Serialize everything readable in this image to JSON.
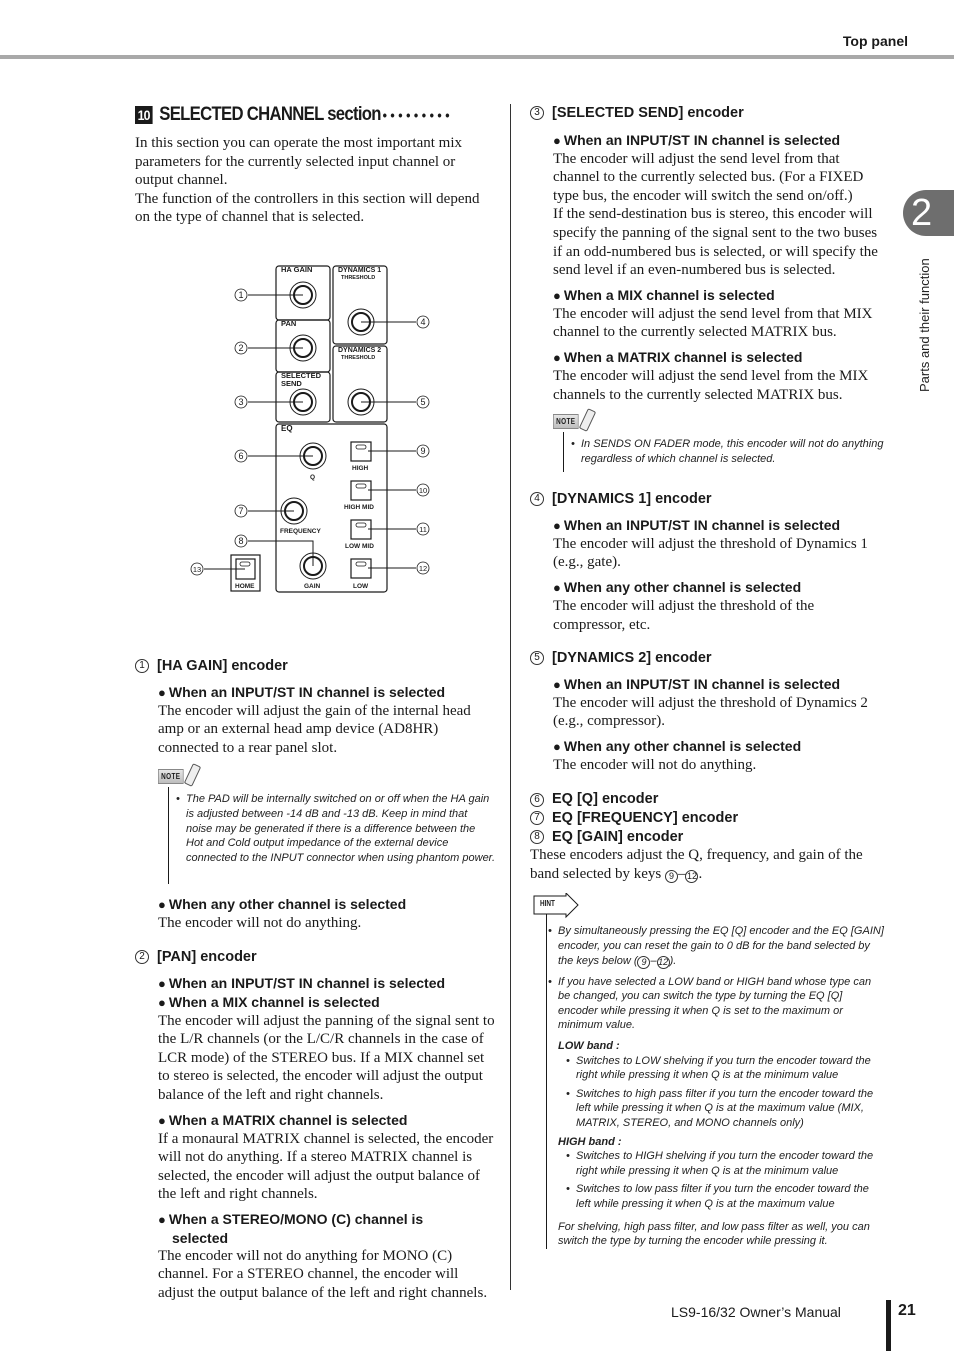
{
  "header": {
    "title": "Top panel"
  },
  "chapter": {
    "number": "2",
    "title": "Parts and their function"
  },
  "section": {
    "number": "10",
    "title": "SELECTED CHANNEL section",
    "dots": "•••••••••",
    "intro": [
      "In this section you can operate the most important mix parameters for the currently selected input channel or output channel.",
      "The function of the controllers in this section will depend on the type of channel that is selected."
    ]
  },
  "diagram": {
    "panels": {
      "ha_gain": "HA GAIN",
      "pan": "PAN",
      "selected_send_1": "SELECTED",
      "selected_send_2": "SEND",
      "dyn1": "DYNAMICS 1",
      "dyn1_sub": "THRESHOLD",
      "dyn2": "DYNAMICS 2",
      "dyn2_sub": "THRESHOLD",
      "eq": "EQ",
      "q": "Q",
      "frequency": "FREQUENCY",
      "gain": "GAIN",
      "high": "HIGH",
      "high_mid": "HIGH MID",
      "low_mid": "LOW MID",
      "low": "LOW",
      "home": "HOME"
    },
    "callouts": [
      "1",
      "2",
      "3",
      "4",
      "5",
      "6",
      "7",
      "8",
      "9",
      "10",
      "11",
      "12",
      "13"
    ]
  },
  "items": {
    "ha_gain": {
      "num": "1",
      "title": "[HA GAIN] encoder",
      "cond1": "When an INPUT/ST IN channel is selected",
      "text1": "The encoder will adjust the gain of the internal head amp or an external head amp device (AD8HR) connected to a rear panel slot.",
      "note_label": "NOTE",
      "note": "The PAD will be internally switched on or off when the HA gain is adjusted between -14 dB and -13 dB. Keep in mind that noise may be generated if there is a difference between the Hot and Cold output impedance of the external device connected to the INPUT connector when using phantom power.",
      "cond2": "When any other channel is selected",
      "text2": "The encoder will not do anything."
    },
    "pan": {
      "num": "2",
      "title": "[PAN] encoder",
      "cond1": "When an INPUT/ST IN channel is selected",
      "cond1b": "When a MIX channel is selected",
      "text1": "The encoder will adjust the panning of the signal sent to the L/R channels (or the L/C/R channels in the case of LCR mode) of the STEREO bus. If a MIX channel set to stereo is selected, the encoder will adjust the output balance of the left and right channels.",
      "cond2": "When a MATRIX channel is selected",
      "text2": "If a monaural MATRIX channel is selected, the encoder will not do anything. If a stereo MATRIX channel is selected, the encoder will adjust the output balance of the left and right channels.",
      "cond3": "When a STEREO/MONO (C) channel is selected",
      "text3": "The encoder will not do anything for MONO (C) channel. For a STEREO channel, the encoder will adjust the output balance of the left and right channels."
    },
    "selected_send": {
      "num": "3",
      "title": "[SELECTED SEND] encoder",
      "cond1": "When an INPUT/ST IN channel is selected",
      "text1": "The encoder will adjust the send level from that channel to the currently selected bus. (For a FIXED type bus, the encoder will switch the send on/off.)",
      "text1b": "If the send-destination bus is stereo, this encoder will specify the panning of the signal sent to the two buses if an odd-numbered bus is selected, or will specify the send level if an even-numbered bus is selected.",
      "cond2": "When a MIX channel is selected",
      "text2": "The encoder will adjust the send level from that MIX channel to the currently selected MATRIX bus.",
      "cond3": "When a MATRIX channel is selected",
      "text3": "The encoder will adjust the send level from the MIX channels to the currently selected MATRIX bus.",
      "note_label": "NOTE",
      "note": "In SENDS ON FADER mode, this encoder will not do anything regardless of which channel is selected."
    },
    "dyn1": {
      "num": "4",
      "title": "[DYNAMICS 1] encoder",
      "cond1": "When an INPUT/ST IN channel is selected",
      "text1": "The encoder will adjust the threshold of Dynamics 1 (e.g., gate).",
      "cond2": "When any other channel is selected",
      "text2": "The encoder will adjust the threshold of the compressor, etc."
    },
    "dyn2": {
      "num": "5",
      "title": "[DYNAMICS 2] encoder",
      "cond1": "When an INPUT/ST IN channel is selected",
      "text1": "The encoder will adjust the threshold of Dynamics 2 (e.g., compressor).",
      "cond2": "When any other channel is selected",
      "text2": "The encoder will not do anything."
    },
    "eq": {
      "num6": "6",
      "title6": "EQ [Q] encoder",
      "num7": "7",
      "title7": "EQ [FREQUENCY] encoder",
      "num8": "8",
      "title8": "EQ [GAIN] encoder",
      "text_a": "These encoders adjust the Q, frequency, and gain of the band selected by keys ",
      "key_from": "9",
      "dash": "–",
      "key_to": "12",
      "text_end": ".",
      "hint_label": "HINT",
      "hint1_a": "By simultaneously pressing the EQ [Q] encoder and the EQ [GAIN] encoder, you can reset the gain to 0 dB for the band selected by the keys below (",
      "hint1_end": ").",
      "hint2": "If you have selected a LOW band or HIGH band whose type can be changed, you can switch the type by turning the EQ [Q] encoder while pressing it when Q is set to the maximum or minimum value.",
      "low_band_label": "LOW band :",
      "low1": "Switches to LOW shelving if you turn the encoder toward the right while pressing it when Q is at the minimum value",
      "low2": "Switches to high pass filter if you turn the encoder toward the left while pressing it when Q is at the maximum value (MIX, MATRIX, STEREO, and MONO channels only)",
      "high_band_label": "HIGH band :",
      "high1": "Switches to HIGH shelving if you turn the encoder toward the right while pressing it when Q is at the minimum value",
      "high2": "Switches to low pass filter if you turn the encoder toward the left while pressing it when Q is at the maximum value",
      "closing": "For shelving, high pass filter, and low pass filter as well, you can switch the type by turning the encoder while pressing it."
    }
  },
  "footer": {
    "manual": "LS9-16/32  Owner’s Manual",
    "page": "21"
  }
}
